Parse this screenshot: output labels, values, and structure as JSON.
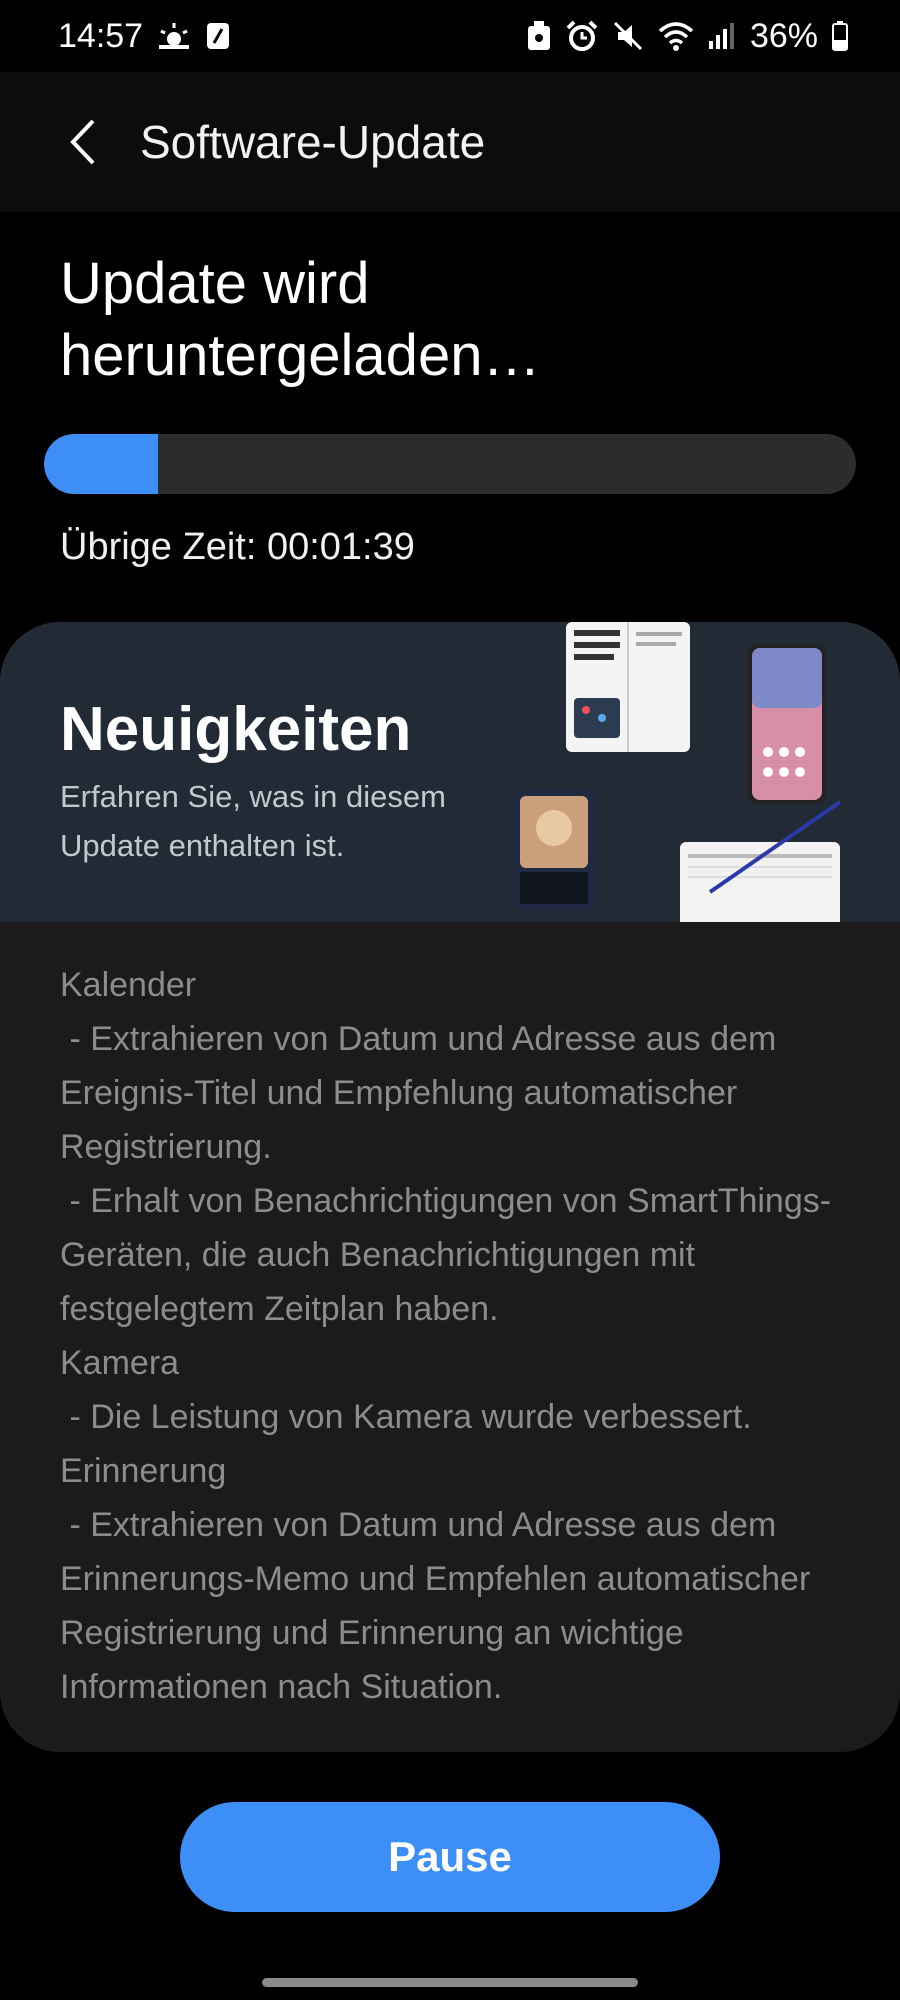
{
  "status_bar": {
    "time": "14:57",
    "battery": "36%",
    "left_icons": [
      "weather-sun-icon",
      "nfc-tag-icon"
    ],
    "right_icons": [
      "android-lock-icon",
      "alarm-icon",
      "mute-icon",
      "wifi-icon",
      "signal-icon",
      "battery-icon"
    ]
  },
  "app_bar": {
    "title": "Software-Update",
    "back_icon": "back-arrow-icon"
  },
  "download": {
    "title": "Update wird heruntergeladen…",
    "progress_fraction": 0.14,
    "remaining_text": "Übrige Zeit: 00:01:39"
  },
  "news": {
    "title": "Neuigkeiten",
    "subtitle": "Erfahren Sie, was in diesem Update enthalten ist.",
    "illustration": "devices-illustration",
    "release_notes": "Kalender\n - Extrahieren von Datum und Adresse aus dem Ereignis-Titel und Empfehlung automatischer Registrierung.\n - Erhalt von Benachrichtigungen von SmartThings-Geräten, die auch Benachrichtigungen mit festgelegtem Zeitplan haben.\nKamera\n - Die Leistung von Kamera wurde verbessert.\nErinnerung\n - Extrahieren von Datum und Adresse aus dem Erinnerungs-Memo und Empfehlen automatischer Registrierung und Erinnerung an wichtige Informationen nach Situation."
  },
  "actions": {
    "pause_label": "Pause"
  },
  "colors": {
    "accent": "#3e8ef7",
    "background": "#000000",
    "card": "#1b1b1b",
    "card_header": "#222a36"
  }
}
